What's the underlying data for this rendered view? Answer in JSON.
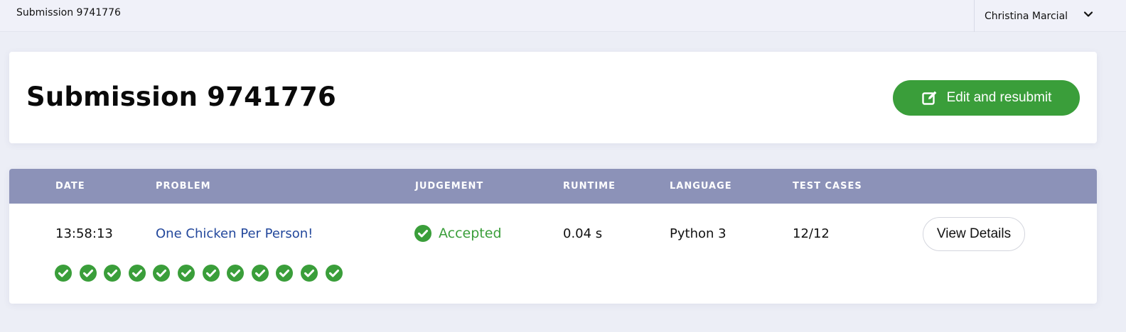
{
  "topbar": {
    "title": "Submission 9741776",
    "user_name": "Christina Marcial",
    "user_menu_icon": "chevron-down-icon"
  },
  "header": {
    "title": "Submission 9741776",
    "resubmit_label": "Edit and resubmit",
    "resubmit_icon": "edit-icon"
  },
  "table": {
    "columns": [
      "DATE",
      "PROBLEM",
      "JUDGEMENT",
      "RUNTIME",
      "LANGUAGE",
      "TEST CASES"
    ],
    "row": {
      "date": "13:58:13",
      "problem": "One Chicken Per Person!",
      "judgement": "Accepted",
      "runtime": "0.04 s",
      "language": "Python 3",
      "test_cases": "12/12",
      "details_label": "View Details"
    },
    "test_case_results": [
      "accepted",
      "accepted",
      "accepted",
      "accepted",
      "accepted",
      "accepted",
      "accepted",
      "accepted",
      "accepted",
      "accepted",
      "accepted",
      "accepted"
    ]
  },
  "colors": {
    "accent_green": "#3a9e3a",
    "header_bg": "#8c92b8",
    "link_blue": "#23489c"
  }
}
